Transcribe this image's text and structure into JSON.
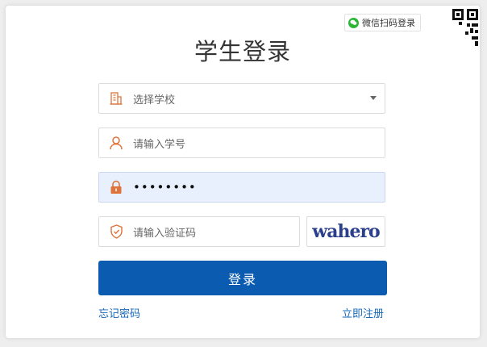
{
  "wechat_login": "微信扫码登录",
  "title": "学生登录",
  "school_select": {
    "placeholder": "选择学校"
  },
  "student_id": {
    "placeholder": "请输入学号"
  },
  "password": {
    "value": "••••••••"
  },
  "captcha": {
    "placeholder": "请输入验证码",
    "image_text": "wahero"
  },
  "login_button": "登录",
  "forgot_password": "忘记密码",
  "register": "立即注册",
  "colors": {
    "accent": "#0b5bb0",
    "icon": "#e0733a",
    "link": "#1668b8"
  },
  "icons": [
    "wechat-icon",
    "qr-code-icon",
    "building-icon",
    "user-icon",
    "lock-icon",
    "shield-icon",
    "caret-down-icon"
  ]
}
